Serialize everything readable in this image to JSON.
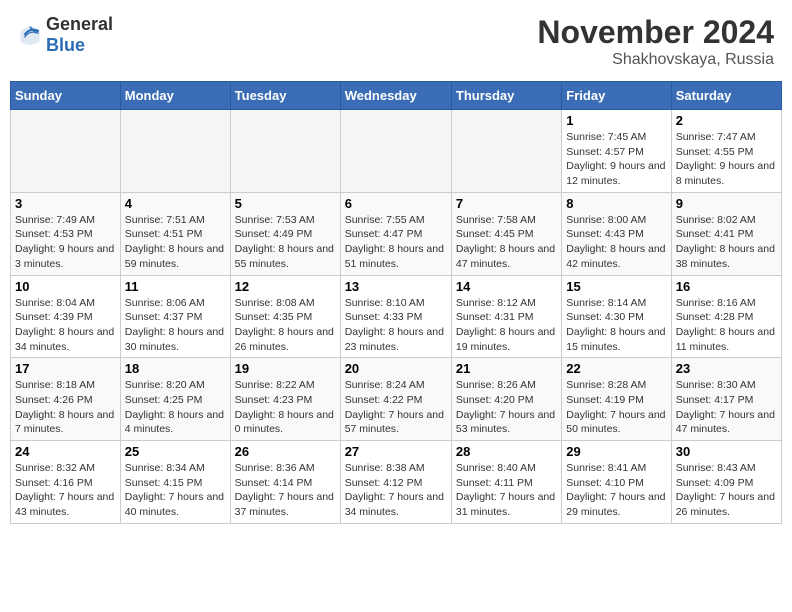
{
  "header": {
    "logo_general": "General",
    "logo_blue": "Blue",
    "month_title": "November 2024",
    "location": "Shakhovskaya, Russia"
  },
  "days_of_week": [
    "Sunday",
    "Monday",
    "Tuesday",
    "Wednesday",
    "Thursday",
    "Friday",
    "Saturday"
  ],
  "weeks": [
    [
      {
        "day": "",
        "empty": true
      },
      {
        "day": "",
        "empty": true
      },
      {
        "day": "",
        "empty": true
      },
      {
        "day": "",
        "empty": true
      },
      {
        "day": "",
        "empty": true
      },
      {
        "day": "1",
        "sunrise": "Sunrise: 7:45 AM",
        "sunset": "Sunset: 4:57 PM",
        "daylight": "Daylight: 9 hours and 12 minutes."
      },
      {
        "day": "2",
        "sunrise": "Sunrise: 7:47 AM",
        "sunset": "Sunset: 4:55 PM",
        "daylight": "Daylight: 9 hours and 8 minutes."
      }
    ],
    [
      {
        "day": "3",
        "sunrise": "Sunrise: 7:49 AM",
        "sunset": "Sunset: 4:53 PM",
        "daylight": "Daylight: 9 hours and 3 minutes."
      },
      {
        "day": "4",
        "sunrise": "Sunrise: 7:51 AM",
        "sunset": "Sunset: 4:51 PM",
        "daylight": "Daylight: 8 hours and 59 minutes."
      },
      {
        "day": "5",
        "sunrise": "Sunrise: 7:53 AM",
        "sunset": "Sunset: 4:49 PM",
        "daylight": "Daylight: 8 hours and 55 minutes."
      },
      {
        "day": "6",
        "sunrise": "Sunrise: 7:55 AM",
        "sunset": "Sunset: 4:47 PM",
        "daylight": "Daylight: 8 hours and 51 minutes."
      },
      {
        "day": "7",
        "sunrise": "Sunrise: 7:58 AM",
        "sunset": "Sunset: 4:45 PM",
        "daylight": "Daylight: 8 hours and 47 minutes."
      },
      {
        "day": "8",
        "sunrise": "Sunrise: 8:00 AM",
        "sunset": "Sunset: 4:43 PM",
        "daylight": "Daylight: 8 hours and 42 minutes."
      },
      {
        "day": "9",
        "sunrise": "Sunrise: 8:02 AM",
        "sunset": "Sunset: 4:41 PM",
        "daylight": "Daylight: 8 hours and 38 minutes."
      }
    ],
    [
      {
        "day": "10",
        "sunrise": "Sunrise: 8:04 AM",
        "sunset": "Sunset: 4:39 PM",
        "daylight": "Daylight: 8 hours and 34 minutes."
      },
      {
        "day": "11",
        "sunrise": "Sunrise: 8:06 AM",
        "sunset": "Sunset: 4:37 PM",
        "daylight": "Daylight: 8 hours and 30 minutes."
      },
      {
        "day": "12",
        "sunrise": "Sunrise: 8:08 AM",
        "sunset": "Sunset: 4:35 PM",
        "daylight": "Daylight: 8 hours and 26 minutes."
      },
      {
        "day": "13",
        "sunrise": "Sunrise: 8:10 AM",
        "sunset": "Sunset: 4:33 PM",
        "daylight": "Daylight: 8 hours and 23 minutes."
      },
      {
        "day": "14",
        "sunrise": "Sunrise: 8:12 AM",
        "sunset": "Sunset: 4:31 PM",
        "daylight": "Daylight: 8 hours and 19 minutes."
      },
      {
        "day": "15",
        "sunrise": "Sunrise: 8:14 AM",
        "sunset": "Sunset: 4:30 PM",
        "daylight": "Daylight: 8 hours and 15 minutes."
      },
      {
        "day": "16",
        "sunrise": "Sunrise: 8:16 AM",
        "sunset": "Sunset: 4:28 PM",
        "daylight": "Daylight: 8 hours and 11 minutes."
      }
    ],
    [
      {
        "day": "17",
        "sunrise": "Sunrise: 8:18 AM",
        "sunset": "Sunset: 4:26 PM",
        "daylight": "Daylight: 8 hours and 7 minutes."
      },
      {
        "day": "18",
        "sunrise": "Sunrise: 8:20 AM",
        "sunset": "Sunset: 4:25 PM",
        "daylight": "Daylight: 8 hours and 4 minutes."
      },
      {
        "day": "19",
        "sunrise": "Sunrise: 8:22 AM",
        "sunset": "Sunset: 4:23 PM",
        "daylight": "Daylight: 8 hours and 0 minutes."
      },
      {
        "day": "20",
        "sunrise": "Sunrise: 8:24 AM",
        "sunset": "Sunset: 4:22 PM",
        "daylight": "Daylight: 7 hours and 57 minutes."
      },
      {
        "day": "21",
        "sunrise": "Sunrise: 8:26 AM",
        "sunset": "Sunset: 4:20 PM",
        "daylight": "Daylight: 7 hours and 53 minutes."
      },
      {
        "day": "22",
        "sunrise": "Sunrise: 8:28 AM",
        "sunset": "Sunset: 4:19 PM",
        "daylight": "Daylight: 7 hours and 50 minutes."
      },
      {
        "day": "23",
        "sunrise": "Sunrise: 8:30 AM",
        "sunset": "Sunset: 4:17 PM",
        "daylight": "Daylight: 7 hours and 47 minutes."
      }
    ],
    [
      {
        "day": "24",
        "sunrise": "Sunrise: 8:32 AM",
        "sunset": "Sunset: 4:16 PM",
        "daylight": "Daylight: 7 hours and 43 minutes."
      },
      {
        "day": "25",
        "sunrise": "Sunrise: 8:34 AM",
        "sunset": "Sunset: 4:15 PM",
        "daylight": "Daylight: 7 hours and 40 minutes."
      },
      {
        "day": "26",
        "sunrise": "Sunrise: 8:36 AM",
        "sunset": "Sunset: 4:14 PM",
        "daylight": "Daylight: 7 hours and 37 minutes."
      },
      {
        "day": "27",
        "sunrise": "Sunrise: 8:38 AM",
        "sunset": "Sunset: 4:12 PM",
        "daylight": "Daylight: 7 hours and 34 minutes."
      },
      {
        "day": "28",
        "sunrise": "Sunrise: 8:40 AM",
        "sunset": "Sunset: 4:11 PM",
        "daylight": "Daylight: 7 hours and 31 minutes."
      },
      {
        "day": "29",
        "sunrise": "Sunrise: 8:41 AM",
        "sunset": "Sunset: 4:10 PM",
        "daylight": "Daylight: 7 hours and 29 minutes."
      },
      {
        "day": "30",
        "sunrise": "Sunrise: 8:43 AM",
        "sunset": "Sunset: 4:09 PM",
        "daylight": "Daylight: 7 hours and 26 minutes."
      }
    ]
  ]
}
